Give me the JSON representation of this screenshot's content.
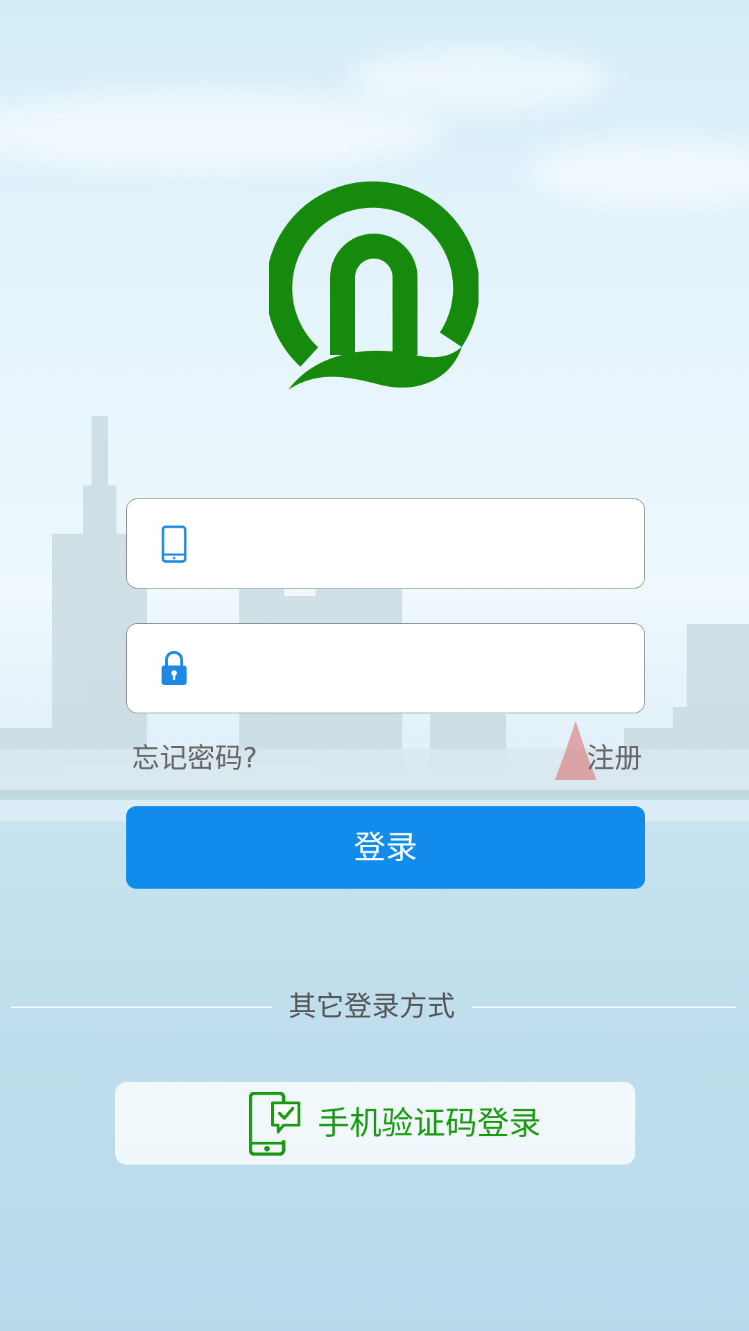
{
  "login_form": {
    "phone_field": {
      "value": "",
      "placeholder": ""
    },
    "password_field": {
      "value": "",
      "placeholder": ""
    },
    "forgot_password_label": "忘记密码?",
    "register_label": "注册",
    "login_button_label": "登录"
  },
  "alternate_login": {
    "divider_label": "其它登录方式",
    "sms_login_label": "手机验证码登录"
  },
  "icons": {
    "logo": "railway-logo-icon",
    "phone_field_icon": "mobile-phone-icon",
    "password_field_icon": "lock-icon",
    "sms_icon": "phone-verify-icon"
  },
  "colors": {
    "logo_green": "#168a0c",
    "primary_blue": "#128cec",
    "sms_green": "#1a9a12",
    "link_gray": "#666666"
  }
}
